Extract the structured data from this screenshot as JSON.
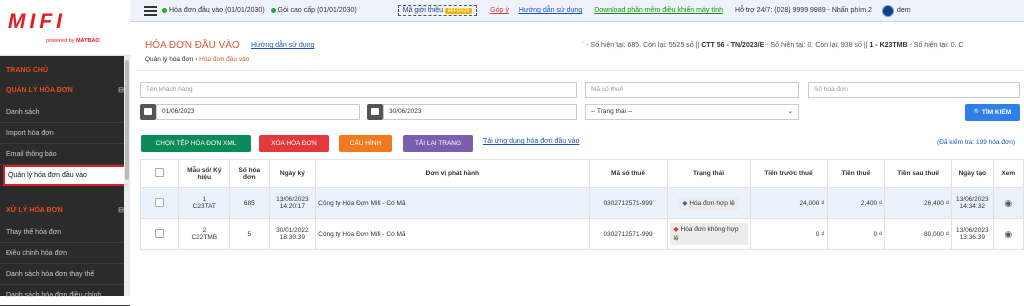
{
  "sidebar": {
    "logo": "MIFI",
    "powered_prefix": "powered by",
    "powered_brand": "MATBAO",
    "section1": "TRANG CHỦ",
    "group1": {
      "title": "QUẢN LÝ HÓA ĐƠN",
      "toggle": "⊟",
      "items": [
        "Danh sách",
        "Import hóa đơn",
        "Email thông báo",
        "Quản lý hóa đơn đầu vào"
      ]
    },
    "group2": {
      "title": "XỬ LÝ HÓA ĐƠN",
      "toggle": "⊟",
      "items": [
        "Thay thế hóa đơn",
        "Điều chỉnh hóa đơn",
        "Danh sách hóa đơn thay thế",
        "Danh sách hóa đơn điều chỉnh"
      ]
    }
  },
  "topbar": {
    "status1": "Hóa đơn đầu vào (01/01/2030)",
    "status2": "Gói cao cấp (01/01/2030)",
    "promo": "Mã giới thiệu",
    "promo_tag": "MIFI2020",
    "feedback": "Góp ý",
    "guide": "Hướng dẫn sử dụng",
    "download": "Download phần mềm điều khiển máy tính",
    "support": "Hỗ trợ 24/7: (028) 9999 9989 - Nhấn phím 2",
    "user": "dem"
  },
  "header": {
    "title": "HÓA ĐƠN ĐẦU VÀO",
    "guide": "Hướng dẫn sử dụng",
    "bc_root": "Quản lý hóa đơn",
    "bc_sep": "›",
    "bc_current": "Hóa đơn đầu vào",
    "info_prefix": "` - Số hiện tại: 685. Còn lại: 5525 số || ",
    "info_b1": "CTT 56 - TN/2023/E",
    "info_mid": " - Số hiện tại: 0. Còn lại: 938 số || ",
    "info_b2": "1 - K23TMB",
    "info_tail": " - Số hiện tại: 0. C"
  },
  "filters": {
    "customer": "Tên khách hàng",
    "tax": "Mã số thuế",
    "invoice_no": "Số hóa đơn",
    "from_date": "01/06/2023",
    "to_date": "30/06/2023",
    "status": "-- Trạng thái --",
    "search": "🔍TÌM KIẾM"
  },
  "actions": {
    "choose_xml": "CHỌN TỆP HÓA ĐƠN XML",
    "delete": "XÓA HÓA ĐƠN",
    "config": "CẤU HÌNH",
    "reload": "TẢI LẠI TRANG",
    "app_link": "Tải ứng dụng hóa đơn đầu vào",
    "checked": "(Đã kiểm tra: 199 hóa đơn)"
  },
  "table": {
    "headers": [
      "Mẫu số/ Ký hiệu",
      "Số hóa đơn",
      "Ngày ký",
      "Đơn vị phát hành",
      "Mã số thuế",
      "Trạng thái",
      "Tiền trước thuế",
      "Tiền thuế",
      "Tiền sau thuế",
      "Ngày tạo",
      "Xem"
    ],
    "rows": [
      {
        "serial1": "1",
        "serial2": "C23TAT",
        "number": "685",
        "signed1": "13/06/2023",
        "signed2": "14:20:17",
        "issuer": "Công ty Hóa Đơn Mifi - Có Mã",
        "tax": "0302712571-999",
        "status": "Hóa đơn hợp lệ",
        "pretax": "24,000 ₫",
        "vat": "2,400 ₫",
        "total": "26,400 ₫",
        "created1": "13/06/2023",
        "created2": "14:34:32"
      },
      {
        "serial1": "2",
        "serial2": "C22TMB",
        "number": "5",
        "signed1": "30/01/2022",
        "signed2": "18:30:39",
        "issuer": "Công ty Hóa Đơn Mifi - Có Mã",
        "tax": "0302712571-999",
        "status": "Hóa đơn không hợp lệ",
        "pretax": "0 ₫",
        "vat": "0 ₫",
        "total": "80,000 ₫",
        "created1": "13/06/2023",
        "created2": "13:36:39"
      }
    ]
  },
  "colors": {
    "accent": "#e05a2a",
    "sidebar_bg": "#2b2b2b",
    "btn_green": "#0d8a5a",
    "btn_red": "#e23a3a",
    "btn_orange": "#f07a1d",
    "btn_purple": "#7a5fb0",
    "btn_blue": "#2f80ed"
  }
}
